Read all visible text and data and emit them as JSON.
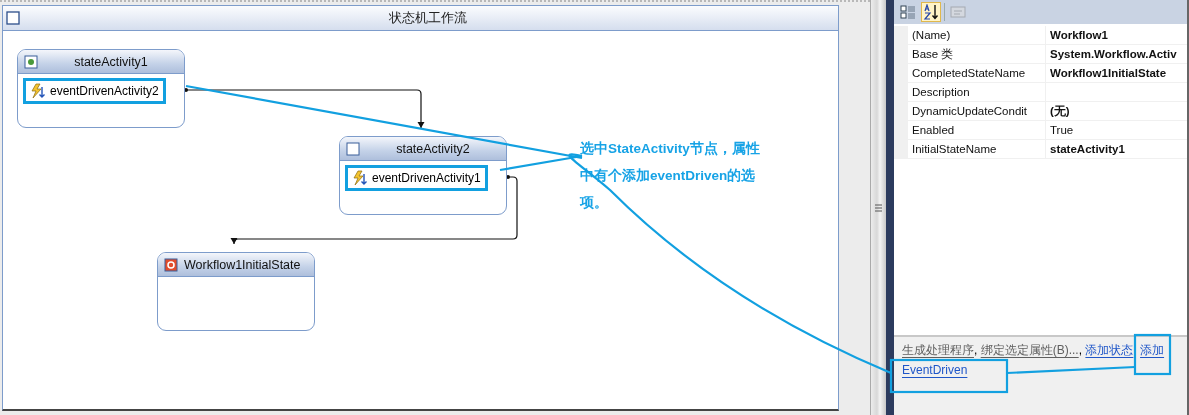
{
  "designer": {
    "title": "状态机工作流",
    "states": [
      {
        "name": "stateActivity1",
        "kind": "initial",
        "events": [
          {
            "name": "eventDrivenActivity2"
          }
        ]
      },
      {
        "name": "stateActivity2",
        "kind": "normal",
        "events": [
          {
            "name": "eventDrivenActivity1"
          }
        ]
      },
      {
        "name": "Workflow1InitialState",
        "kind": "completed"
      }
    ]
  },
  "annotation": {
    "text": "选中StateActivity节点，属性中有个添加eventDriven的选项。"
  },
  "properties": {
    "toolbar": [
      {
        "kind": "categorized",
        "selected": false
      },
      {
        "kind": "alphabetical",
        "selected": true
      },
      {
        "kind": "pages",
        "selected": false
      }
    ],
    "rows": [
      {
        "name": "(Name)",
        "value": "Workflow1",
        "modified": true
      },
      {
        "name": "Base 类",
        "value": "System.Workflow.Activ",
        "modified": true
      },
      {
        "name": "CompletedStateName",
        "value": "Workflow1InitialState",
        "modified": true
      },
      {
        "name": "Description"
      },
      {
        "name": "DynamicUpdateCondit",
        "value": "(无)",
        "modified": true
      },
      {
        "name": "Enabled",
        "value": "True",
        "modified": false
      },
      {
        "name": "InitialStateName",
        "value": "stateActivity1",
        "modified": true
      }
    ],
    "separator": ",",
    "commands": [
      {
        "label": "生成处理程序",
        "disabled": true
      },
      {
        "label": "绑定选定属性(B)...",
        "disabled": true
      },
      {
        "label": "添加状态",
        "disabled": false
      },
      {
        "lines": [
          "添加",
          "EventDriven"
        ],
        "disabled": false
      }
    ]
  }
}
